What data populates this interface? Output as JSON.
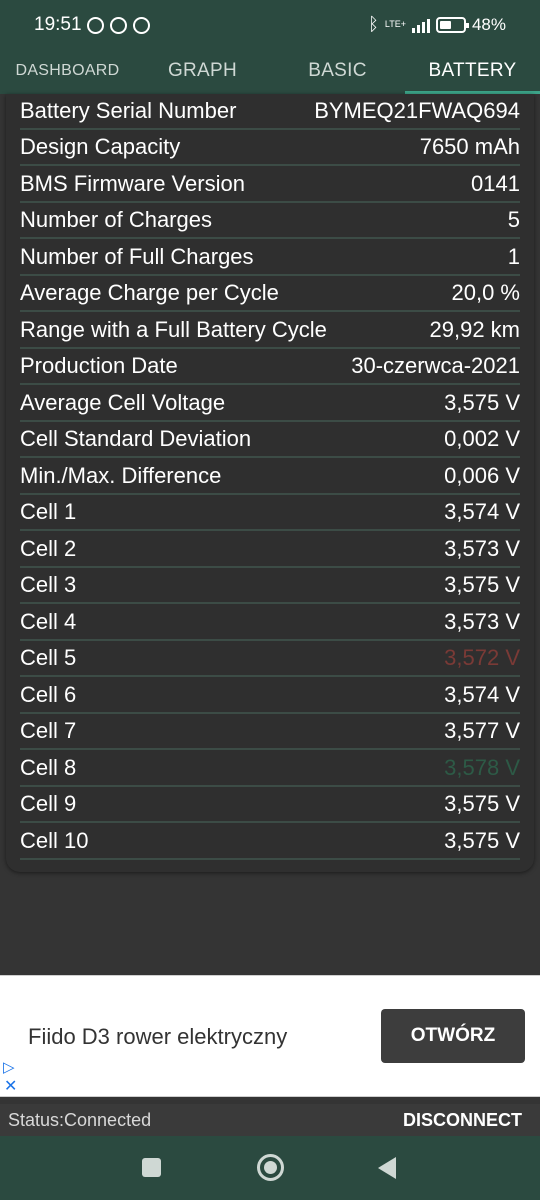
{
  "status_bar": {
    "time": "19:51",
    "network": "LTE+",
    "battery_percent": "48%",
    "battery_level": 0.48
  },
  "tabs": [
    {
      "label": "DASHBOARD"
    },
    {
      "label": "GRAPH"
    },
    {
      "label": "BASIC"
    },
    {
      "label": "BATTERY"
    }
  ],
  "active_tab": "BATTERY",
  "battery_info": [
    {
      "label": "Battery Serial Number",
      "value": "BYMEQ21FWAQ694"
    },
    {
      "label": "Design Capacity",
      "value": "7650 mAh"
    },
    {
      "label": "BMS Firmware Version",
      "value": "0141"
    },
    {
      "label": "Number of Charges",
      "value": "5"
    },
    {
      "label": "Number of Full Charges",
      "value": "1"
    },
    {
      "label": "Average Charge per Cycle",
      "value": "20,0 %"
    },
    {
      "label": "Range with a Full Battery Cycle",
      "value": "29,92 km"
    },
    {
      "label": "Production Date",
      "value": "30-czerwca-2021"
    },
    {
      "label": "Average Cell Voltage",
      "value": "3,575 V"
    },
    {
      "label": "Cell Standard Deviation",
      "value": "0,002 V"
    },
    {
      "label": "Min./Max. Difference",
      "value": "0,006 V"
    },
    {
      "label": "Cell 1",
      "value": "3,574 V"
    },
    {
      "label": "Cell 2",
      "value": "3,573 V"
    },
    {
      "label": "Cell 3",
      "value": "3,575 V"
    },
    {
      "label": "Cell 4",
      "value": "3,573 V"
    },
    {
      "label": "Cell 5",
      "value": "3,572 V"
    },
    {
      "label": "Cell 6",
      "value": "3,574 V"
    },
    {
      "label": "Cell 7",
      "value": "3,577 V"
    },
    {
      "label": "Cell 8",
      "value": "3,578 V"
    },
    {
      "label": "Cell 9",
      "value": "3,575 V"
    },
    {
      "label": "Cell 10",
      "value": "3,575 V"
    }
  ],
  "highlight_colors": {
    "min_cell": "#7a3a36",
    "max_cell": "#2d5a46",
    "accent": "#3da58a",
    "app_bar": "#2b4a40"
  },
  "ad": {
    "title": "Fiido D3 rower elektryczny",
    "button_label": "OTWÓRZ"
  },
  "connection": {
    "status": "Status:Connected",
    "button_label": "DISCONNECT"
  }
}
